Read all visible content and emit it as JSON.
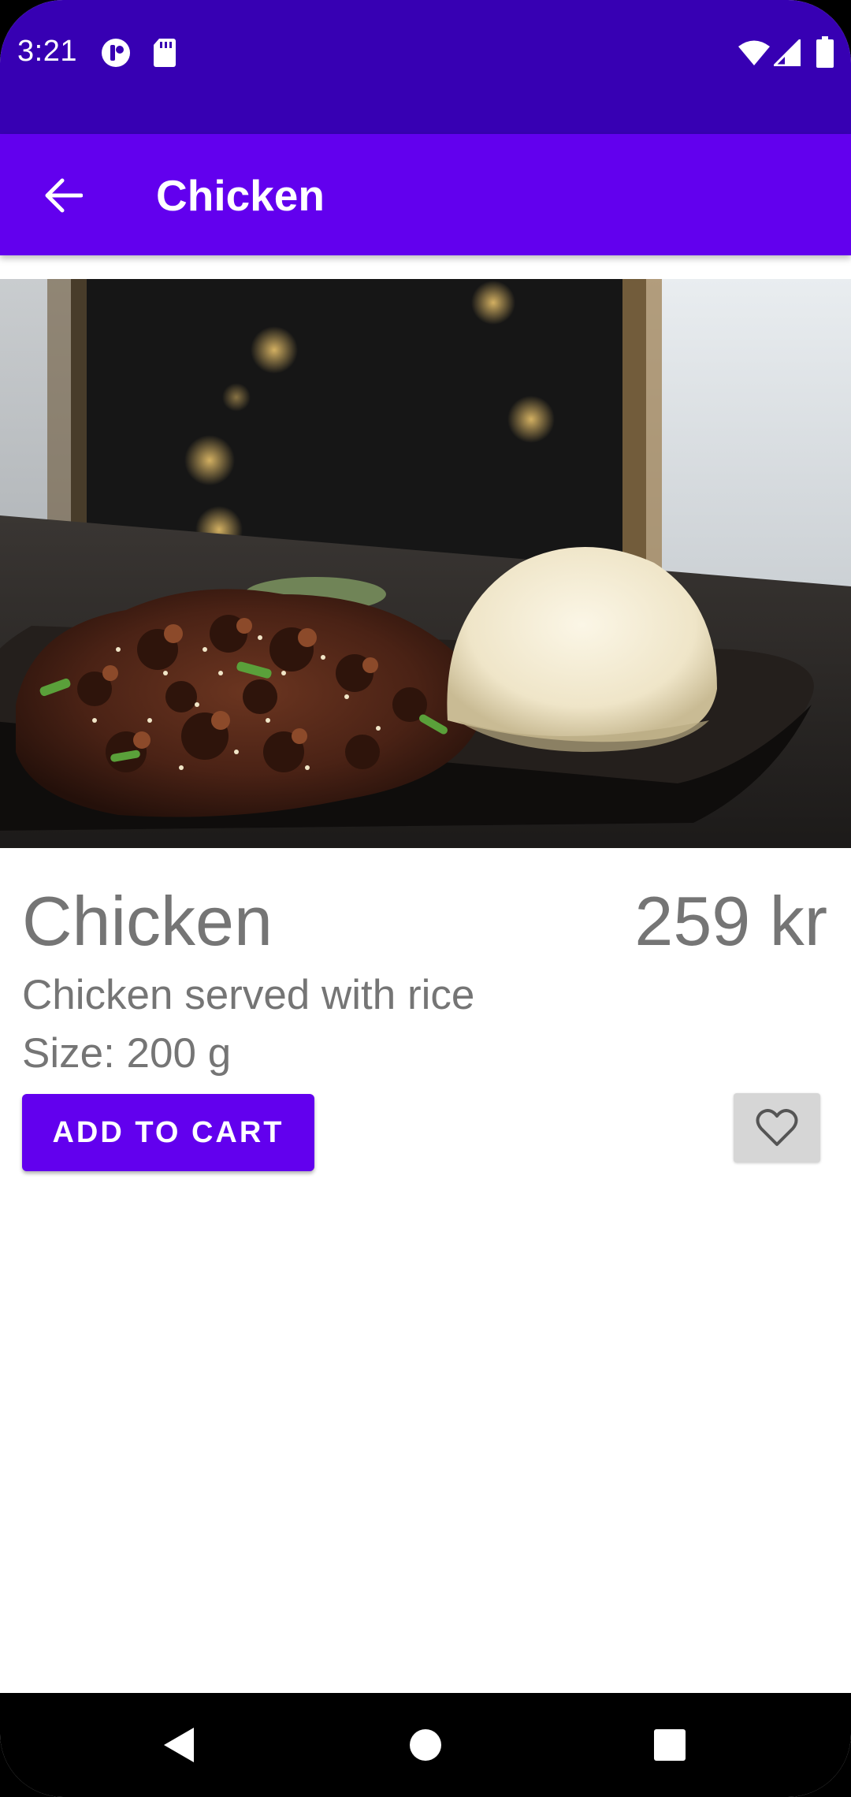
{
  "status_bar": {
    "time": "3:21"
  },
  "app_bar": {
    "title": "Chicken",
    "back_icon": "arrow-left-icon"
  },
  "product": {
    "name": "Chicken",
    "price": "259 kr",
    "description": "Chicken served with rice",
    "size": "Size: 200 g",
    "add_to_cart_label": "ADD TO CART",
    "favorite_icon": "heart-outline-icon"
  },
  "colors": {
    "status_bar": "#3700b3",
    "primary": "#6200ee",
    "text_secondary": "#757575",
    "favorite_bg": "#d6d6d6"
  },
  "nav_bar": {
    "icons": [
      "back-triangle-icon",
      "home-circle-icon",
      "recents-square-icon"
    ]
  }
}
